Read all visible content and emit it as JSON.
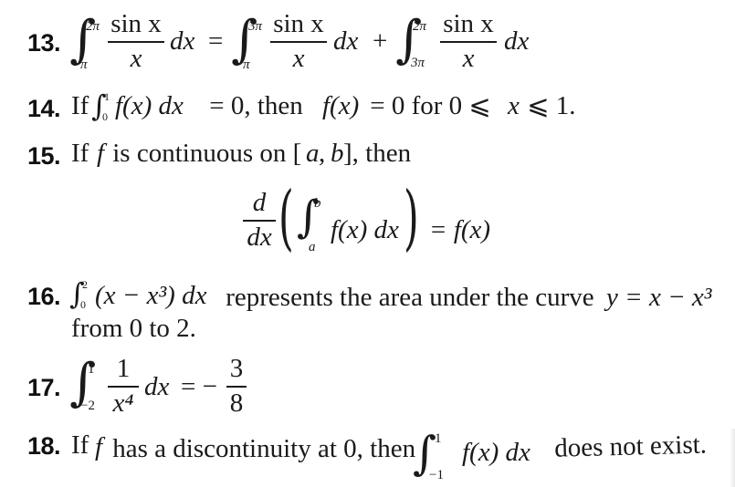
{
  "problems": [
    {
      "number": "13.",
      "parts": {
        "int1_upper": "2π",
        "int1_lower": "π",
        "frac1_num": "sin x",
        "frac1_den": "x",
        "dx1": "dx",
        "eq": "=",
        "int2_upper": "3π",
        "int2_lower": "π",
        "frac2_num": "sin x",
        "frac2_den": "x",
        "dx2": "dx",
        "plus": "+",
        "int3_upper": "2π",
        "int3_lower": "3π",
        "frac3_num": "sin x",
        "frac3_den": "x",
        "dx3": "dx"
      }
    },
    {
      "number": "14.",
      "parts": {
        "pre": "If",
        "int_upper": "1",
        "int_lower": "0",
        "integrand": "f(x) dx",
        "mid": " = 0, then ",
        "fx": "f(x)",
        "post": " = 0 for 0 ⩽ ",
        "x": "x",
        "end": " ⩽ 1."
      }
    },
    {
      "number": "15.",
      "parts": {
        "pre": "If ",
        "f": "f",
        "mid": " is continuous on [",
        "a": "a",
        "comma": ", ",
        "b": "b",
        "end": "], then",
        "display_d": "d",
        "display_dx": "dx",
        "display_upper": "b",
        "display_lower": "a",
        "display_integrand": "f(x) dx",
        "display_eq": "= f(x)"
      }
    },
    {
      "number": "16.",
      "parts": {
        "int_upper": "2",
        "int_lower": "0",
        "integrand": "(x − x³) dx",
        "text": " represents the area under the curve ",
        "curve": "y = x − x³",
        "line2": "from 0 to 2."
      }
    },
    {
      "number": "17.",
      "parts": {
        "int_upper": "1",
        "int_lower": "−2",
        "frac_num": "1",
        "frac_den": "x⁴",
        "dx": "dx",
        "eq": "= −",
        "res_num": "3",
        "res_den": "8"
      }
    },
    {
      "number": "18.",
      "parts": {
        "pre": "If ",
        "f": "f",
        "mid": " has a discontinuity at 0, then ",
        "int_upper": "1",
        "int_lower": "−1",
        "integrand": "f(x) dx",
        "end": " does not exist."
      }
    }
  ]
}
